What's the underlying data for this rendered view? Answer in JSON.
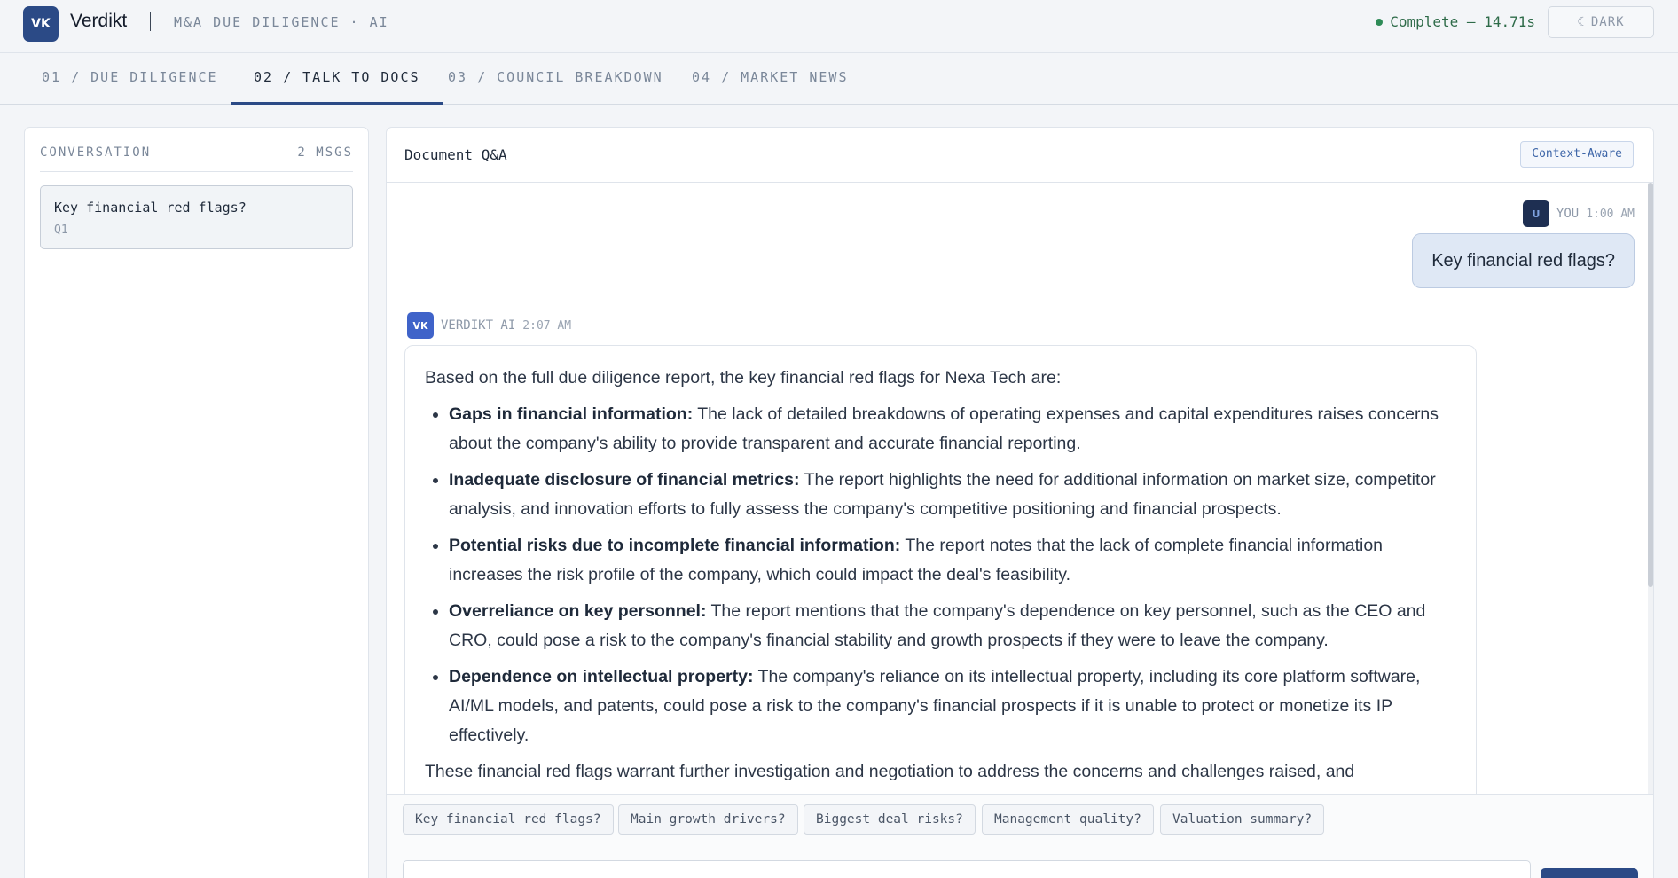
{
  "header": {
    "logo_text": "VK",
    "brand": "Verdikt",
    "subtitle": "M&A DUE DILIGENCE · AI",
    "status": "Complete — 14.71s",
    "theme_icon": "☾",
    "theme_label": "DARK"
  },
  "tabs": [
    {
      "label": "01 / DUE DILIGENCE",
      "active": false
    },
    {
      "label": "02 / TALK TO DOCS",
      "active": true
    },
    {
      "label": "03 / COUNCIL BREAKDOWN",
      "active": false
    },
    {
      "label": "04 / MARKET NEWS",
      "active": false
    }
  ],
  "sidebar": {
    "title": "CONVERSATION",
    "count": "2 MSGS",
    "items": [
      {
        "question": "Key financial red flags?",
        "id": "Q1"
      }
    ]
  },
  "main": {
    "title": "Document Q&A",
    "badge": "Context-Aware",
    "user_msg": {
      "avatar": "U",
      "author": "YOU",
      "time": "1:00 AM",
      "text": "Key financial red flags?"
    },
    "ai_msg": {
      "avatar": "VK",
      "author": "VERDIKT AI",
      "time": "2:07 AM",
      "intro": "Based on the full due diligence report, the key financial red flags for Nexa Tech are:",
      "points": [
        {
          "term": "Gaps in financial information:",
          "text": " The lack of detailed breakdowns of operating expenses and capital expenditures raises concerns about the company's ability to provide transparent and accurate financial reporting."
        },
        {
          "term": "Inadequate disclosure of financial metrics:",
          "text": " The report highlights the need for additional information on market size, competitor analysis, and innovation efforts to fully assess the company's competitive positioning and financial prospects."
        },
        {
          "term": "Potential risks due to incomplete financial information:",
          "text": " The report notes that the lack of complete financial information increases the risk profile of the company, which could impact the deal's feasibility."
        },
        {
          "term": "Overreliance on key personnel:",
          "text": " The report mentions that the company's dependence on key personnel, such as the CEO and CRO, could pose a risk to the company's financial stability and growth prospects if they were to leave the company."
        },
        {
          "term": "Dependence on intellectual property:",
          "text": " The company's reliance on its intellectual property, including its core platform software, AI/ML models, and patents, could pose a risk to the company's financial prospects if it is unable to protect or monetize its IP effectively."
        }
      ],
      "outro": "These financial red flags warrant further investigation and negotiation to address the concerns and challenges raised, and"
    }
  },
  "suggestions": [
    "Key financial red flags?",
    "Main growth drivers?",
    "Biggest deal risks?",
    "Management quality?",
    "Valuation summary?"
  ],
  "colors": {
    "accent": "#2b4a86",
    "status_green": "#2e8b57",
    "ai_avatar": "#3f63c9",
    "user_bubble": "#dfe8f5"
  }
}
